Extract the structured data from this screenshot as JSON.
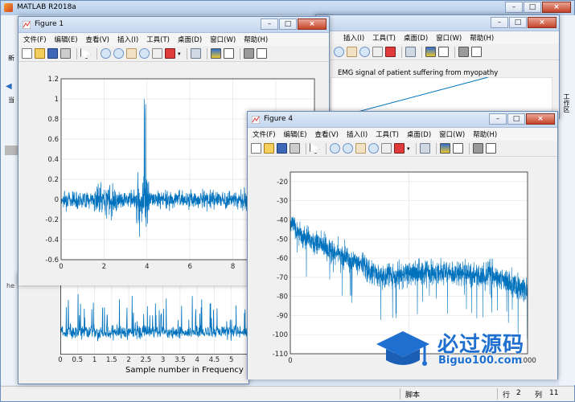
{
  "matlab": {
    "title": "MATLAB R2018a",
    "left_fragments": [
      "新",
      "当"
    ],
    "right_fragment": "工作区",
    "he_fragment": "he"
  },
  "menus": [
    "文件(F)",
    "编辑(E)",
    "查看(V)",
    "插入(I)",
    "工具(T)",
    "桌面(D)",
    "窗口(W)",
    "帮助(H)"
  ],
  "figure1": {
    "title": "Figure 1",
    "chart_data": {
      "type": "line",
      "x_ticks": [
        0,
        2,
        4,
        6,
        8,
        10
      ],
      "y_ticks": [
        -0.6,
        -0.4,
        -0.2,
        0,
        0.2,
        0.4,
        0.6,
        0.8,
        1,
        1.2
      ],
      "x_tick_labels": [
        "0",
        "2",
        "4",
        "6",
        "8",
        "10"
      ],
      "y_tick_labels": [
        "-0.6",
        "-0.4",
        "-0.2",
        "0",
        "0.2",
        "0.4",
        "0.6",
        "0.8",
        "1",
        "1.2"
      ],
      "xlim": [
        0,
        11.8
      ],
      "ylim": [
        -0.6,
        1.2
      ],
      "grid": true
    }
  },
  "figure2_back": {
    "title": "EMG signal of patient suffering from myopathy",
    "menus_visible": [
      "插入(I)",
      "工具(T)",
      "桌面(D)",
      "窗口(W)",
      "帮助(H)"
    ]
  },
  "figure3_back": {
    "xlabel": "Sample number in Frequency",
    "ylabel_fragment": "Re",
    "chart_data": {
      "type": "line",
      "x_ticks": [
        0,
        0.5,
        1,
        1.5,
        2,
        2.5,
        3,
        3.5,
        4,
        4.5,
        5
      ],
      "x_tick_labels": [
        "0",
        "0.5",
        "1",
        "1.5",
        "2",
        "2.5",
        "3",
        "3.5",
        "4",
        "4.5",
        "5"
      ],
      "xlim": [
        0,
        5.5
      ],
      "grid": true
    }
  },
  "figure4": {
    "title": "Figure 4",
    "chart_data": {
      "type": "line",
      "x_ticks": [
        0,
        500,
        1000
      ],
      "x_tick_labels": [
        "0",
        "500",
        "1000"
      ],
      "y_ticks": [
        -110,
        -100,
        -90,
        -80,
        -70,
        -60,
        -50,
        -40,
        -30,
        -20
      ],
      "y_tick_labels": [
        "-110",
        "-100",
        "-90",
        "-80",
        "-70",
        "-60",
        "-50",
        "-40",
        "-30",
        "-20"
      ],
      "xlim": [
        0,
        1000
      ],
      "ylim": [
        -110,
        -15
      ],
      "grid": true
    }
  },
  "statusbar": {
    "script_label": "脚本",
    "row_label": "行",
    "row_value": "2",
    "col_label": "列",
    "col_value": "11"
  },
  "watermark": {
    "brand": "必过源码",
    "url": "Biguo100.com"
  },
  "colors": {
    "line": "#0072bd",
    "grid": "#e5e5e5"
  }
}
